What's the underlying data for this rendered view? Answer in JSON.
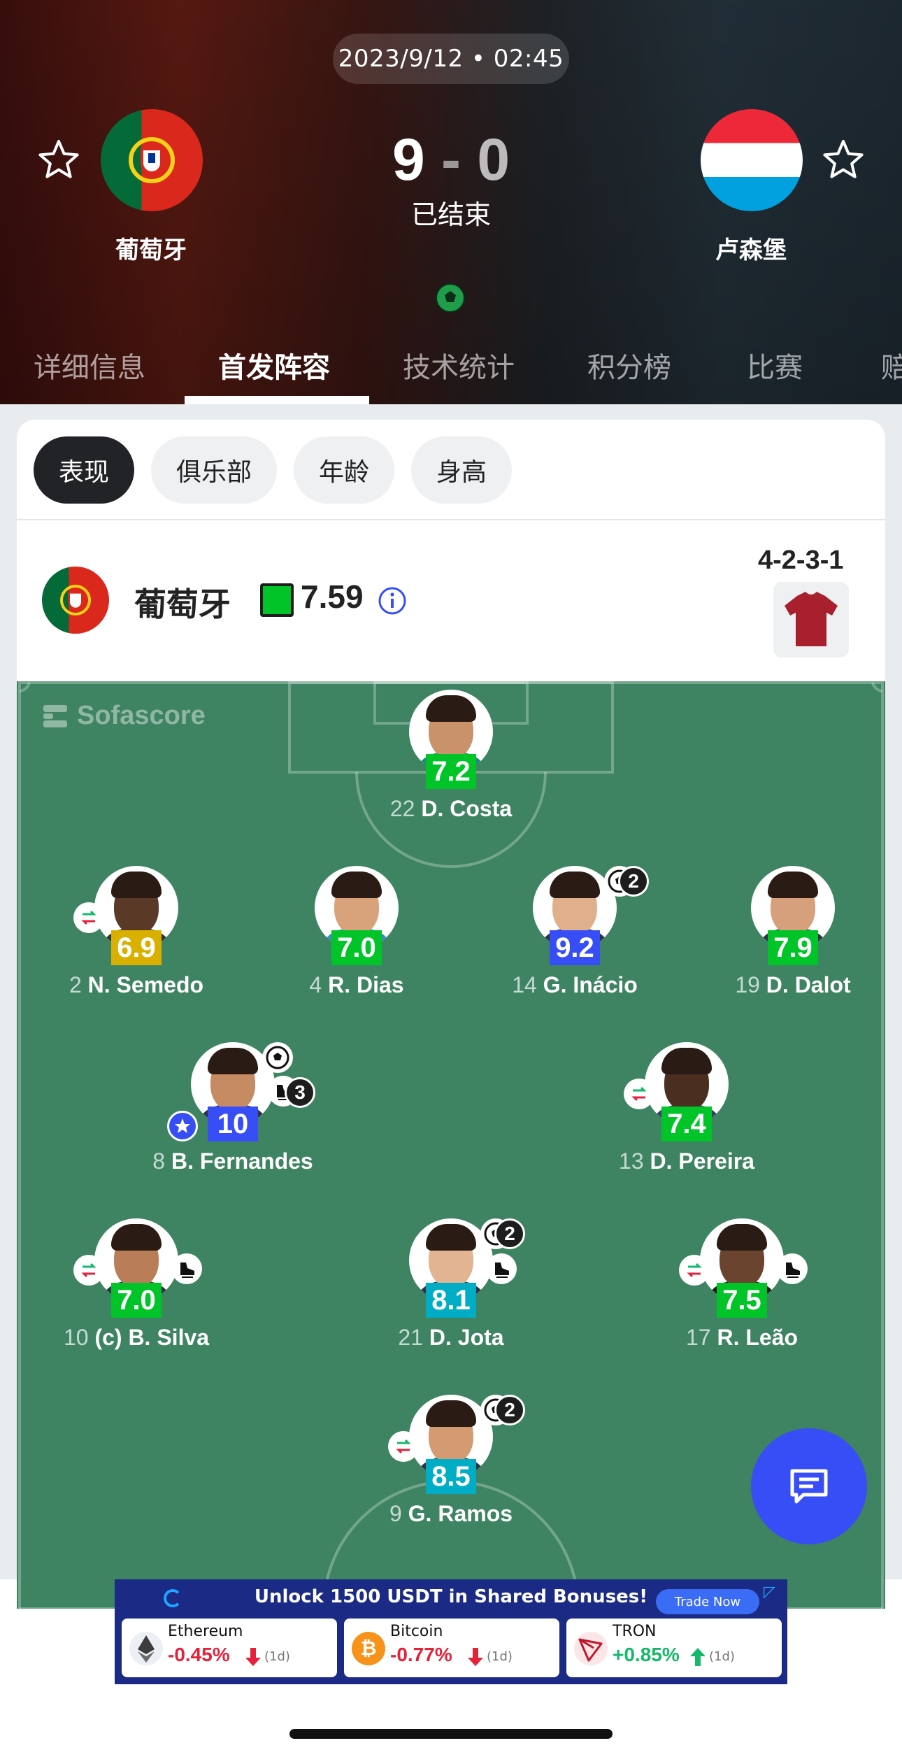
{
  "match": {
    "datetime": "2023/9/12 • 02:45",
    "home_team": "葡萄牙",
    "away_team": "卢森堡",
    "home_score": "9",
    "score_sep": " - ",
    "away_score": "0",
    "status": "已结束"
  },
  "tabs": [
    {
      "label": "详细信息",
      "active": false
    },
    {
      "label": "首发阵容",
      "active": true
    },
    {
      "label": "技术统计",
      "active": false
    },
    {
      "label": "积分榜",
      "active": false
    },
    {
      "label": "比赛",
      "active": false
    },
    {
      "label": "赔",
      "active": false
    }
  ],
  "filters": [
    {
      "label": "表现",
      "active": true
    },
    {
      "label": "俱乐部",
      "active": false
    },
    {
      "label": "年龄",
      "active": false
    },
    {
      "label": "身高",
      "active": false
    }
  ],
  "team_summary": {
    "name": "葡萄牙",
    "average_rating": "7.59",
    "formation": "4-2-3-1"
  },
  "watermark": "Sofascore",
  "players": [
    {
      "number": "22",
      "name": "D. Costa",
      "rating": "7.2",
      "rating_color": "#00c428",
      "sub": false,
      "goals": 0,
      "assists": 0,
      "motm": false
    },
    {
      "number": "2",
      "name": "N. Semedo",
      "rating": "6.9",
      "rating_color": "#d9af00",
      "sub": true,
      "goals": 0,
      "assists": 0,
      "motm": false
    },
    {
      "number": "4",
      "name": "R. Dias",
      "rating": "7.0",
      "rating_color": "#00c428",
      "sub": false,
      "goals": 0,
      "assists": 0,
      "motm": false
    },
    {
      "number": "14",
      "name": "G. Inácio",
      "rating": "9.2",
      "rating_color": "#374df5",
      "sub": false,
      "goals": 2,
      "assists": 0,
      "motm": false
    },
    {
      "number": "19",
      "name": "D. Dalot",
      "rating": "7.9",
      "rating_color": "#00c428",
      "sub": false,
      "goals": 0,
      "assists": 0,
      "motm": false
    },
    {
      "number": "8",
      "name": "B. Fernandes",
      "rating": "10",
      "rating_color": "#374df5",
      "sub": false,
      "goals": 1,
      "assists": 3,
      "motm": true
    },
    {
      "number": "13",
      "name": "D. Pereira",
      "rating": "7.4",
      "rating_color": "#00c428",
      "sub": true,
      "goals": 0,
      "assists": 0,
      "motm": false
    },
    {
      "number": "10",
      "name": "(c) B. Silva",
      "rating": "7.0",
      "rating_color": "#00c428",
      "sub": true,
      "goals": 0,
      "assists": 1,
      "motm": false
    },
    {
      "number": "21",
      "name": "D. Jota",
      "rating": "8.1",
      "rating_color": "#00adc4",
      "sub": false,
      "goals": 2,
      "assists": 1,
      "motm": false
    },
    {
      "number": "17",
      "name": "R. Leão",
      "rating": "7.5",
      "rating_color": "#00c428",
      "sub": true,
      "goals": 0,
      "assists": 1,
      "motm": false
    },
    {
      "number": "9",
      "name": "G. Ramos",
      "rating": "8.5",
      "rating_color": "#00adc4",
      "sub": true,
      "goals": 2,
      "assists": 0,
      "motm": false
    }
  ],
  "ad": {
    "title": "Unlock 1500 USDT in Shared Bonuses!",
    "button": "Trade Now",
    "coins": [
      {
        "name": "Ethereum",
        "change": "-0.45%",
        "period": "(1d)",
        "direction": "down"
      },
      {
        "name": "Bitcoin",
        "change": "-0.77%",
        "period": "(1d)",
        "direction": "down"
      },
      {
        "name": "TRON",
        "change": "+0.85%",
        "period": "(1d)",
        "direction": "up"
      }
    ]
  },
  "colors": {
    "accent_blue": "#374df5",
    "pitch_green": "#3e8462",
    "rating_green": "#00c428",
    "down_red": "#e4233b",
    "up_green": "#16b86b"
  }
}
